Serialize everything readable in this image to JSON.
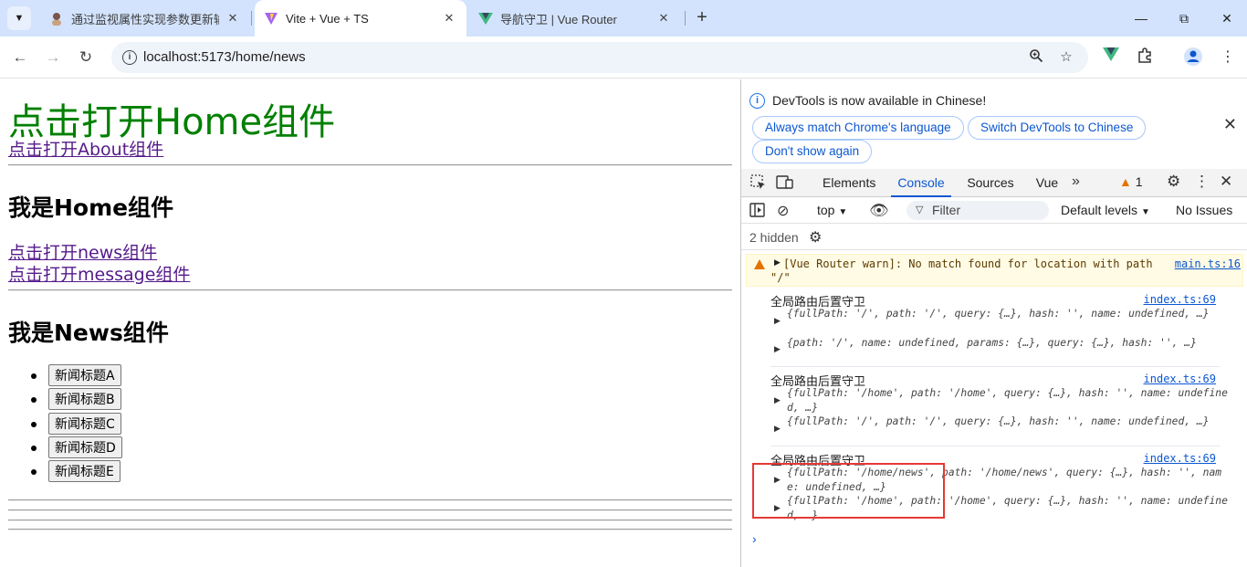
{
  "browser": {
    "tabs": [
      {
        "title": "通过监视属性实现参数更新输出",
        "active": false
      },
      {
        "title": "Vite + Vue + TS",
        "active": true
      },
      {
        "title": "导航守卫 | Vue Router",
        "active": false
      }
    ],
    "url": "localhost:5173/home/news"
  },
  "page": {
    "heading": "点击打开Home组件",
    "about_link": "点击打开About组件",
    "home_title": "我是Home组件",
    "news_link": "点击打开news组件",
    "message_link": "点击打开message组件",
    "news_title": "我是News组件",
    "news_buttons": [
      "新闻标题A",
      "新闻标题B",
      "新闻标题C",
      "新闻标题D",
      "新闻标题E"
    ]
  },
  "devtools": {
    "banner_text": "DevTools is now available in Chinese!",
    "banner_buttons": [
      "Always match Chrome's language",
      "Switch DevTools to Chinese",
      "Don't show again"
    ],
    "tabs": [
      "Elements",
      "Console",
      "Sources",
      "Vue"
    ],
    "active_tab": "Console",
    "warning_count": "1",
    "context": "top",
    "filter_placeholder": "Filter",
    "levels": "Default levels",
    "issues": "No Issues",
    "hidden": "2 hidden",
    "console": {
      "warning": {
        "text": "[Vue Router warn]: No match found for location with path",
        "text2": "\"/\"",
        "source": "main.ts:16"
      },
      "groups": [
        {
          "title": "全局路由后置守卫",
          "source": "index.ts:69",
          "lines": [
            "{fullPath: '/', path: '/', query: {…}, hash: '', name: undefined, …}",
            "{path: '/', name: undefined, params: {…}, query: {…}, hash: '', …}"
          ]
        },
        {
          "title": "全局路由后置守卫",
          "source": "index.ts:69",
          "lines": [
            "{fullPath: '/home', path: '/home', query: {…}, hash: '', name: undefined, …}",
            "{fullPath: '/', path: '/', query: {…}, hash: '', name: undefined, …}"
          ]
        },
        {
          "title": "全局路由后置守卫",
          "source": "index.ts:69",
          "lines": [
            "{fullPath: '/home/news', path: '/home/news', query: {…}, hash: '', name: undefined, …}",
            "{fullPath: '/home', path: '/home', query: {…}, hash: '', name: undefined, …}"
          ]
        }
      ]
    }
  },
  "colors": {
    "heading_green": "#008000",
    "link_purple": "#551a8b",
    "devtools_accent": "#0b57d0",
    "highlight_red": "#e53935"
  }
}
